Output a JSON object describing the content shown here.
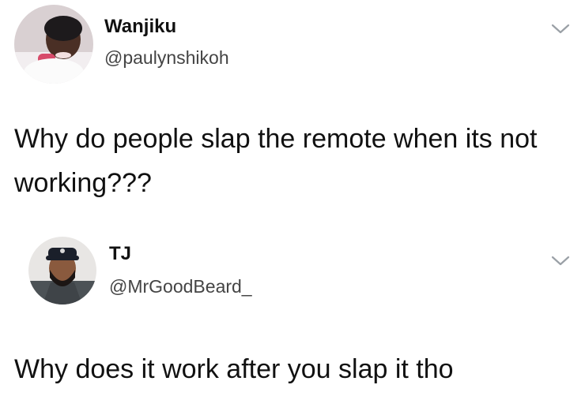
{
  "tweets": [
    {
      "display_name": "Wanjiku",
      "handle": "@paulynshikoh",
      "text": "Why do people slap the remote when its not working???",
      "avatar_icon": "profile-photo"
    },
    {
      "display_name": "TJ",
      "handle": "@MrGoodBeard_",
      "text": "Why does it work after you slap it tho",
      "avatar_icon": "profile-photo"
    }
  ],
  "icons": {
    "menu": "chevron-down-icon"
  },
  "colors": {
    "background": "#ffffff",
    "text": "#111111",
    "handle": "#444444",
    "chevron": "#9aa0a6"
  }
}
